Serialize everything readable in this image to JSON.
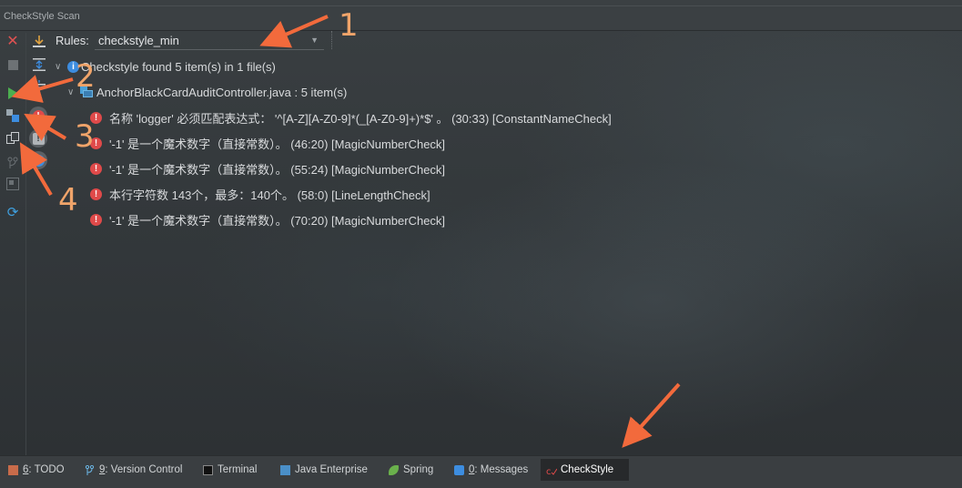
{
  "window": {
    "title": "CheckStyle Scan"
  },
  "toolbar": {
    "left_icons": [
      "close-icon",
      "stop-icon",
      "run-icon",
      "module-icon",
      "copy-icon",
      "branch-icon",
      "compare-icon",
      "refresh-icon"
    ],
    "second_icons": [
      "download-icon",
      "expand-all-icon",
      "collapse-all-icon"
    ],
    "severity_filters": [
      {
        "name": "error-filter",
        "symbol": "!",
        "color": "#e04a4a"
      },
      {
        "name": "warning-filter",
        "symbol": "!",
        "color": "#b0b4b8"
      },
      {
        "name": "info-filter",
        "symbol": "i",
        "color": "#3d8de0"
      }
    ]
  },
  "rules": {
    "label": "Rules:",
    "selected": "checkstyle_min"
  },
  "tree": {
    "root": "Checkstyle found 5 item(s) in 1 file(s)",
    "file": "AnchorBlackCardAuditController.java : 5 item(s)",
    "items": [
      {
        "text": "名称 'logger' 必须匹配表达式： '^[A-Z][A-Z0-9]*(_[A-Z0-9]+)*$' 。 (30:33) [ConstantNameCheck]"
      },
      {
        "text": "'-1' 是一个魔术数字（直接常数）。 (46:20) [MagicNumberCheck]"
      },
      {
        "text": "'-1' 是一个魔术数字（直接常数）。 (55:24) [MagicNumberCheck]"
      },
      {
        "text": "本行字符数 143个，最多：140个。 (58:0) [LineLengthCheck]"
      },
      {
        "text": "'-1' 是一个魔术数字（直接常数）。 (70:20) [MagicNumberCheck]"
      }
    ]
  },
  "bottom_tabs": [
    {
      "num": "6",
      "label": ": TODO",
      "icon": "todo-icon"
    },
    {
      "num": "9",
      "label": ": Version Control",
      "icon": "vcs-icon"
    },
    {
      "num": "",
      "label": "Terminal",
      "icon": "terminal-icon"
    },
    {
      "num": "",
      "label": "Java Enterprise",
      "icon": "java-enterprise-icon"
    },
    {
      "num": "",
      "label": "Spring",
      "icon": "spring-icon"
    },
    {
      "num": "0",
      "label": ": Messages",
      "icon": "messages-icon"
    },
    {
      "num": "",
      "label": "CheckStyle",
      "icon": "checkstyle-icon",
      "active": true
    }
  ],
  "annotations": [
    "1",
    "2",
    "3",
    "4"
  ],
  "colors": {
    "error": "#e04a4a",
    "info": "#3d8de0",
    "arrow": "#f26a3c",
    "run": "#4caf50"
  }
}
